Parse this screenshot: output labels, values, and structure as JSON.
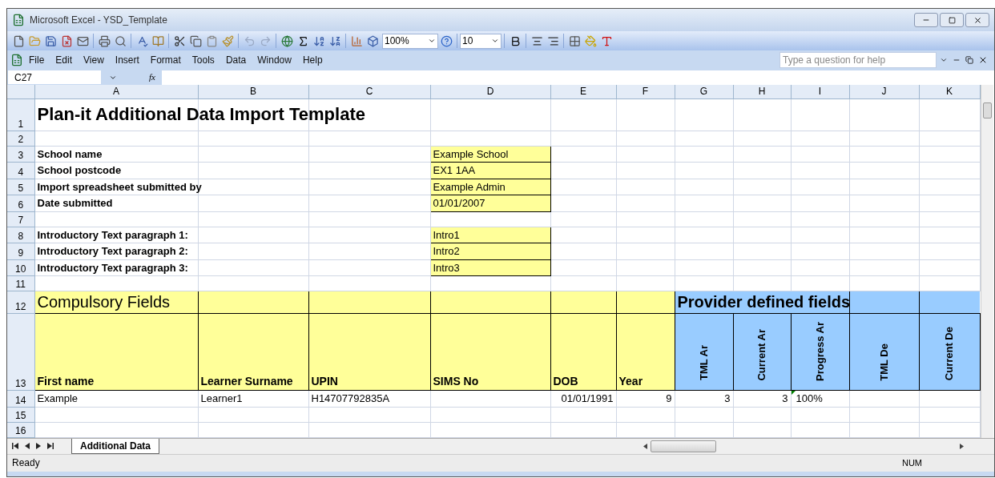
{
  "window": {
    "title": "Microsoft Excel - YSD_Template"
  },
  "toolbar": {
    "zoom": "100%",
    "font_size": "10"
  },
  "menu": [
    "File",
    "Edit",
    "View",
    "Insert",
    "Format",
    "Tools",
    "Data",
    "Window",
    "Help"
  ],
  "help_search": {
    "placeholder": "Type a question for help"
  },
  "formula_bar": {
    "name_box": "C27",
    "fx": "fx"
  },
  "columns": [
    "A",
    "B",
    "C",
    "D",
    "E",
    "F",
    "G",
    "H",
    "I",
    "J",
    "K"
  ],
  "rows": [
    {
      "number": "1",
      "kind": "title",
      "cells": {
        "A": {
          "kind": "title",
          "text": "Plan-it Additional Data Import Template"
        }
      }
    },
    {
      "number": "2",
      "kind": "normal",
      "cells": {}
    },
    {
      "number": "3",
      "kind": "normal",
      "cells": {
        "A": {
          "kind": "label",
          "text": "School name"
        },
        "D": {
          "kind": "input",
          "text": "Example School"
        }
      }
    },
    {
      "number": "4",
      "kind": "normal",
      "cells": {
        "A": {
          "kind": "label",
          "text": "School postcode"
        },
        "D": {
          "kind": "input",
          "text": "EX1 1AA"
        }
      }
    },
    {
      "number": "5",
      "kind": "normal",
      "cells": {
        "A": {
          "kind": "label",
          "text": "Import spreadsheet submitted by"
        },
        "D": {
          "kind": "input",
          "text": "Example Admin"
        }
      }
    },
    {
      "number": "6",
      "kind": "normal",
      "cells": {
        "A": {
          "kind": "label",
          "text": "Date submitted"
        },
        "D": {
          "kind": "input",
          "text": "01/01/2007"
        }
      }
    },
    {
      "number": "7",
      "kind": "normal",
      "cells": {}
    },
    {
      "number": "8",
      "kind": "normal",
      "cells": {
        "A": {
          "kind": "label",
          "text": "Introductory Text paragraph 1:"
        },
        "D": {
          "kind": "input",
          "text": "Intro1"
        }
      }
    },
    {
      "number": "9",
      "kind": "normal",
      "cells": {
        "A": {
          "kind": "label",
          "text": "Introductory Text paragraph 2:"
        },
        "D": {
          "kind": "input",
          "text": "Intro2"
        }
      }
    },
    {
      "number": "10",
      "kind": "normal",
      "cells": {
        "A": {
          "kind": "label",
          "text": "Introductory Text paragraph 3:"
        },
        "D": {
          "kind": "input",
          "text": "Intro3"
        }
      }
    },
    {
      "number": "11",
      "kind": "normal",
      "cells": {}
    },
    {
      "number": "12",
      "kind": "section",
      "cells": {
        "A": {
          "kind": "section_yellow",
          "text": "Compulsory Fields"
        },
        "B": {
          "kind": "section_yellow"
        },
        "C": {
          "kind": "section_yellow"
        },
        "D": {
          "kind": "section_yellow"
        },
        "E": {
          "kind": "section_yellow"
        },
        "F": {
          "kind": "section_yellow"
        },
        "G": {
          "kind": "section_blue",
          "text": "Provider defined fields"
        },
        "H": {
          "kind": "merged"
        },
        "I": {
          "kind": "merged"
        },
        "J": {
          "kind": "section_blue"
        },
        "K": {
          "kind": "section_blue"
        }
      }
    },
    {
      "number": "13",
      "kind": "header",
      "cells": {
        "A": {
          "kind": "header_yellow",
          "text": "First name"
        },
        "B": {
          "kind": "header_yellow",
          "text": "Learner Surname"
        },
        "C": {
          "kind": "header_yellow",
          "text": "UPIN"
        },
        "D": {
          "kind": "header_yellow",
          "text": "SIMS No"
        },
        "E": {
          "kind": "header_yellow",
          "text": "DOB"
        },
        "F": {
          "kind": "header_yellow",
          "text": "Year"
        },
        "G": {
          "kind": "header_vertical",
          "text": "TML Ar"
        },
        "H": {
          "kind": "header_vertical",
          "text": "Current Ar"
        },
        "I": {
          "kind": "header_vertical",
          "text": "Progress Ar"
        },
        "J": {
          "kind": "header_vertical",
          "text": "TML De"
        },
        "K": {
          "kind": "header_vertical",
          "text": "Current De"
        }
      }
    },
    {
      "number": "14",
      "kind": "normal",
      "cells": {
        "A": {
          "kind": "text",
          "text": "Example"
        },
        "B": {
          "kind": "text",
          "text": "Learner1"
        },
        "C": {
          "kind": "text",
          "text": "H14707792835A"
        },
        "E": {
          "kind": "number",
          "text": "01/01/1991"
        },
        "F": {
          "kind": "number",
          "text": "9"
        },
        "G": {
          "kind": "number",
          "text": "3"
        },
        "H": {
          "kind": "number",
          "text": "3"
        },
        "I": {
          "kind": "text",
          "text": "100%",
          "error_marker": true
        }
      }
    },
    {
      "number": "15",
      "kind": "normal",
      "cells": {}
    },
    {
      "number": "16",
      "kind": "normal",
      "cells": {}
    }
  ],
  "sheet_tabs": [
    {
      "label": "Additional Data",
      "selected": true
    }
  ],
  "status_bar": {
    "status": "Ready",
    "num_lock": "NUM"
  }
}
